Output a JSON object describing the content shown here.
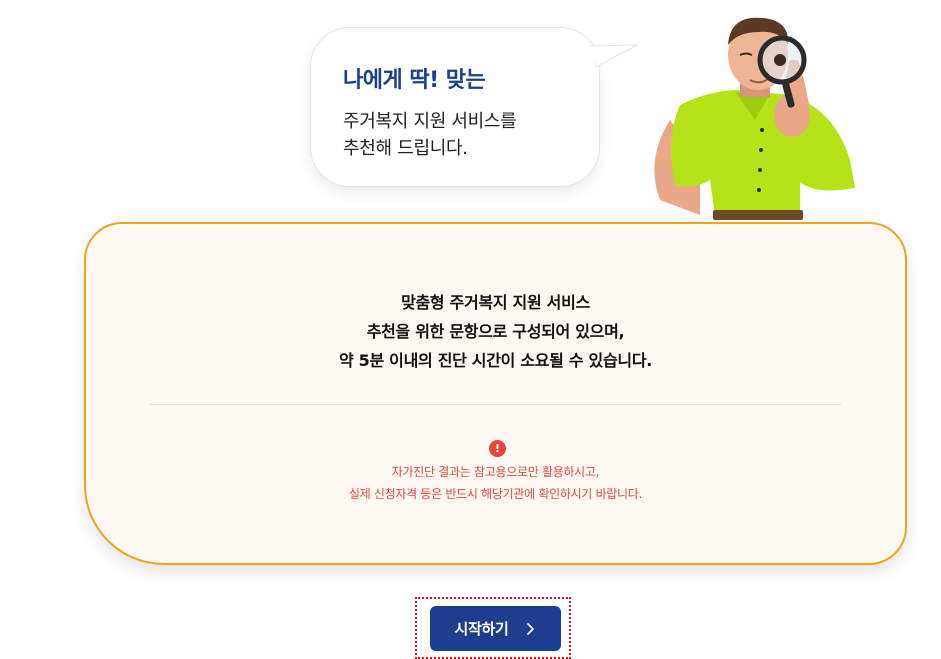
{
  "bubble": {
    "title": "나에게 딱! 맞는",
    "line1": "주거복지 지원 서비스를",
    "line2": "추천해 드립니다."
  },
  "card": {
    "line1": "맞춤형 주거복지 지원 서비스",
    "line2": "추천을 위한 문항으로 구성되어 있으며,",
    "line3": "약 5분 이내의 진단 시간이 소요될 수 있습니다.",
    "warning_icon": "!",
    "warning_line1": "자가진단 결과는 참고용으로만 활용하시고,",
    "warning_line2": "실제 신청자격 등은 반드시 해당기관에 확인하시기 바랍니다."
  },
  "start_button": {
    "label": "시작하기",
    "icon": "chevron-right-icon"
  },
  "colors": {
    "brand": "#1d3d8f",
    "card_border": "#f3a21a",
    "card_bg": "#fff9f3",
    "warning": "#e34b3e",
    "focus_outline": "#d4121f"
  }
}
